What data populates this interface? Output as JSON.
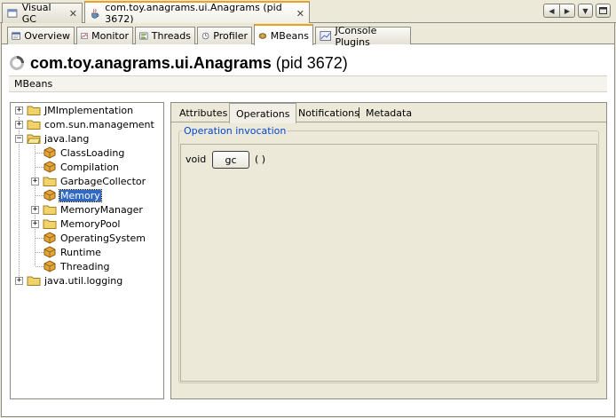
{
  "doc_tabs": [
    {
      "label": "Visual GC",
      "active": false
    },
    {
      "label": "com.toy.anagrams.ui.Anagrams (pid 3672)",
      "active": true
    }
  ],
  "view_tabs": [
    {
      "label": "Overview",
      "icon": "overview-icon"
    },
    {
      "label": "Monitor",
      "icon": "monitor-icon"
    },
    {
      "label": "Threads",
      "icon": "threads-icon"
    },
    {
      "label": "Profiler",
      "icon": "profiler-icon"
    },
    {
      "label": "MBeans",
      "icon": "mbeans-icon",
      "active": true
    },
    {
      "label": "JConsole Plugins",
      "icon": "jconsole-plugins-icon"
    }
  ],
  "heading": {
    "app_name": "com.toy.anagrams.ui.Anagrams",
    "pid": "(pid 3672)"
  },
  "section_label": "MBeans",
  "tree": [
    {
      "label": "JMImplementation",
      "type": "folder",
      "expander": "+"
    },
    {
      "label": "com.sun.management",
      "type": "folder",
      "expander": "+"
    },
    {
      "label": "java.lang",
      "type": "folder",
      "expander": "-"
    },
    {
      "label": "ClassLoading",
      "type": "bean"
    },
    {
      "label": "Compilation",
      "type": "bean"
    },
    {
      "label": "GarbageCollector",
      "type": "folder",
      "expander": "+"
    },
    {
      "label": "Memory",
      "type": "bean",
      "selected": true
    },
    {
      "label": "MemoryManager",
      "type": "folder",
      "expander": "+"
    },
    {
      "label": "MemoryPool",
      "type": "folder",
      "expander": "+"
    },
    {
      "label": "OperatingSystem",
      "type": "bean"
    },
    {
      "label": "Runtime",
      "type": "bean"
    },
    {
      "label": "Threading",
      "type": "bean"
    },
    {
      "label": "java.util.logging",
      "type": "folder",
      "expander": "+"
    }
  ],
  "detail_tabs": [
    "Attributes",
    "Operations",
    "Notifications",
    "Metadata"
  ],
  "operation": {
    "group_title": "Operation invocation",
    "return_type": "void",
    "button_label": "gc",
    "params": "( )"
  },
  "colors": {
    "accent_tab": "#f0a020",
    "selection": "#316ac5",
    "group_title": "#0046d5",
    "background": "#ece9d8"
  }
}
